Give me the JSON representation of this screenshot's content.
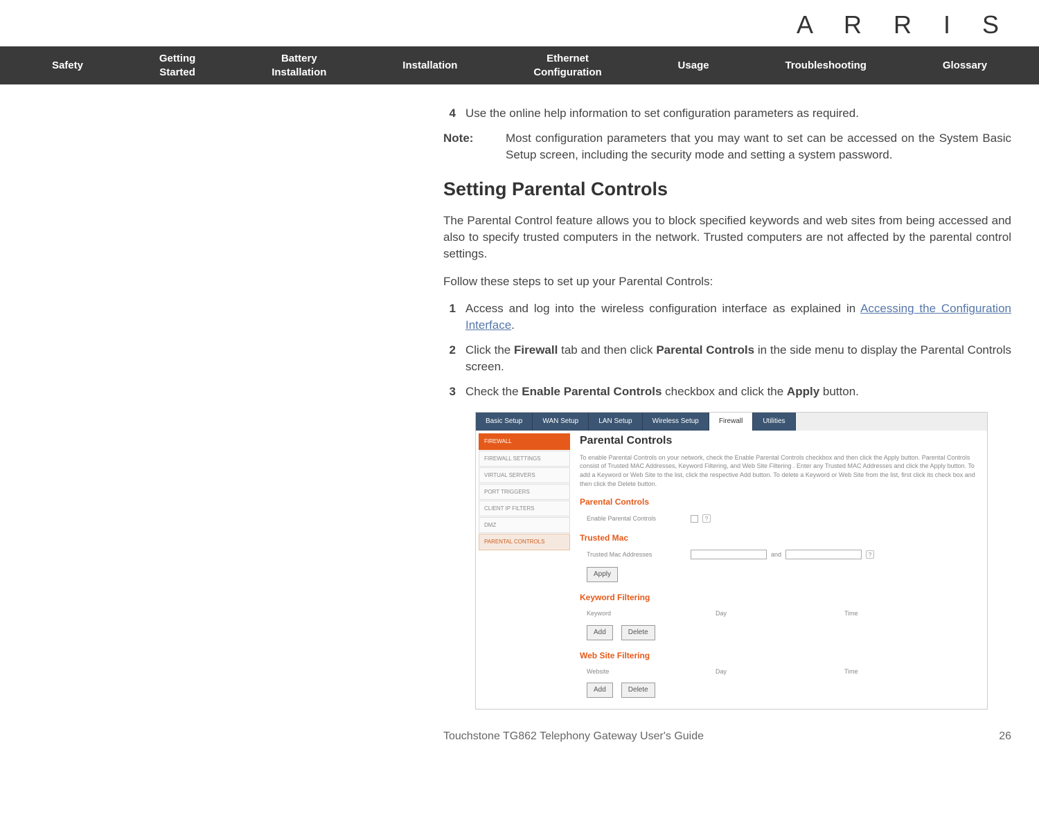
{
  "logo": "A R R I S",
  "nav": {
    "safety": "Safety",
    "getting_started": "Getting\nStarted",
    "battery": "Battery\nInstallation",
    "installation": "Installation",
    "ethernet": "Ethernet\nConfiguration",
    "usage": "Usage",
    "troubleshooting": "Troubleshooting",
    "glossary": "Glossary"
  },
  "top_step": {
    "num": "4",
    "text": "Use the online help information to set configuration parameters as required."
  },
  "note": {
    "label": "Note:",
    "text": "Most configuration parameters that you may want to set can be accessed on the System Basic Setup screen, including the security mode and setting a system password."
  },
  "section_title": "Setting Parental Controls",
  "intro": "The Parental Control feature allows you to block specified keywords and web sites from being accessed and also to specify trusted computers in the network. Trusted computers are not affected by the parental control settings.",
  "follow": "Follow these steps to set up your Parental Controls:",
  "steps": {
    "s1": {
      "num": "1",
      "pre": "Access and log into the wireless configuration interface as explained in ",
      "link": "Accessing the Configuration Interface",
      "post": "."
    },
    "s2": {
      "num": "2",
      "a": "Click the ",
      "b": "Firewall",
      "c": " tab and then click ",
      "d": "Parental Controls",
      "e": " in the side menu to display the Parental Controls screen."
    },
    "s3": {
      "num": "3",
      "a": "Check the ",
      "b": "Enable Parental Controls",
      "c": " checkbox and click the ",
      "d": "Apply",
      "e": " button."
    }
  },
  "shot": {
    "tabs": {
      "basic": "Basic Setup",
      "wan": "WAN Setup",
      "lan": "LAN Setup",
      "wireless": "Wireless Setup",
      "firewall": "Firewall",
      "util": "Utilities"
    },
    "side": {
      "fire": "FIREWALL",
      "fs": "FIREWALL SETTINGS",
      "vs": "VIRTUAL SERVERS",
      "pt": "PORT TRIGGERS",
      "cif": "CLIENT IP FILTERS",
      "dmz": "DMZ",
      "pc": "PARENTAL CONTROLS"
    },
    "title": "Parental Controls",
    "desc": "To enable Parental Controls on your network, check the Enable Parental Controls checkbox and then click the Apply button. Parental Controls consist of Trusted MAC Addresses, Keyword Filtering, and Web Site Filtering . Enter any Trusted MAC Addresses and click the Apply button. To add a Keyword or Web Site to the list, click the respective Add button. To delete a Keyword or Web Site from the list, first click its check box and then click the Delete button.",
    "pc_head": "Parental Controls",
    "pc_label": "Enable Parental Controls",
    "tm_head": "Trusted Mac",
    "tm_label": "Trusted Mac Addresses",
    "tm_and": "and",
    "apply": "Apply",
    "kf_head": "Keyword Filtering",
    "kf_cols": {
      "a": "Keyword",
      "b": "Day",
      "c": "Time"
    },
    "add": "Add",
    "del": "Delete",
    "wf_head": "Web Site Filtering",
    "wf_cols": {
      "a": "Website",
      "b": "Day",
      "c": "Time"
    }
  },
  "footer": {
    "title": "Touchstone TG862 Telephony Gateway User's Guide",
    "page": "26"
  }
}
